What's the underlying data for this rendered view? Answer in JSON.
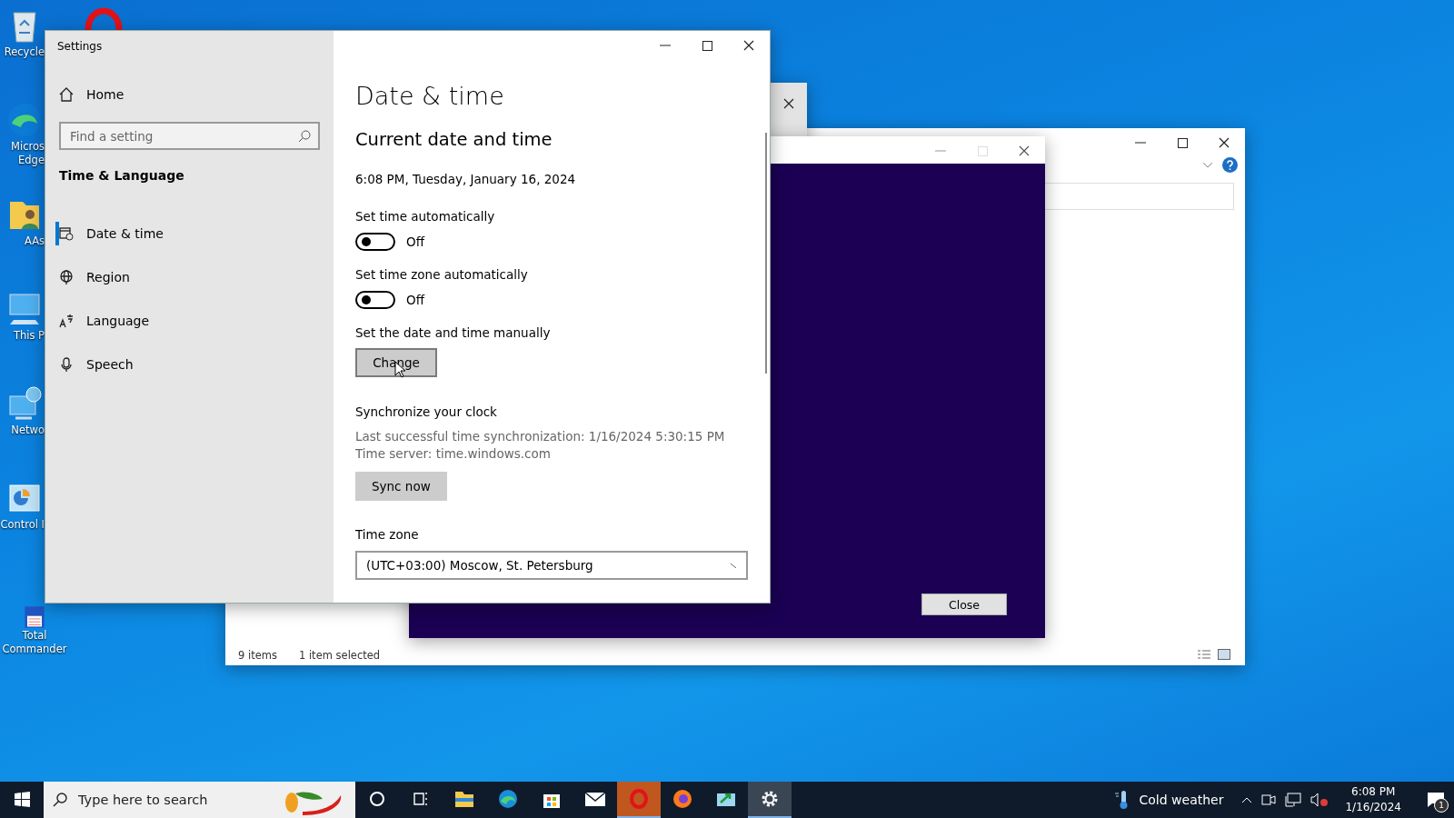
{
  "desktop_icons": [
    {
      "kind": "recycle",
      "lines": [
        "Recycle"
      ]
    },
    {
      "kind": "edge",
      "lines": [
        "Micros",
        "Edge"
      ]
    },
    {
      "kind": "user-folder",
      "lines": [
        "AAs"
      ]
    },
    {
      "kind": "pc",
      "lines": [
        "This P"
      ]
    },
    {
      "kind": "network",
      "lines": [
        "Netwo"
      ]
    },
    {
      "kind": "control",
      "lines": [
        "Control I"
      ]
    },
    {
      "kind": "floppy",
      "lines": [
        "Total",
        "Commander"
      ]
    }
  ],
  "explorer": {
    "status": [
      "9 items",
      "1 item selected"
    ]
  },
  "dialog": {
    "button": "Close"
  },
  "settings": {
    "title": "Settings",
    "home": "Home",
    "search": {
      "placeholder": "Find a setting"
    },
    "category": "Time & Language",
    "nav": [
      {
        "kind": "calendar",
        "label": "Date & time",
        "selected": true
      },
      {
        "kind": "globe",
        "label": "Region",
        "selected": false
      },
      {
        "kind": "language",
        "label": "Language",
        "selected": false
      },
      {
        "kind": "mic",
        "label": "Speech",
        "selected": false
      }
    ],
    "heading": "Date & time",
    "section": "Current date and time",
    "current": "6:08 PM, Tuesday, January 16, 2024",
    "toggles": [
      {
        "label": "Set time automatically",
        "on": false,
        "state": "Off"
      },
      {
        "label": "Set time zone automatically",
        "on": false,
        "state": "Off"
      }
    ],
    "manual": {
      "label": "Set the date and time manually",
      "button": "Change"
    },
    "sync": {
      "title": "Synchronize your clock",
      "lines": [
        "Last successful time synchronization: 1/16/2024 5:30:15 PM",
        "Time server: time.windows.com"
      ],
      "button": "Sync now"
    },
    "timezone": {
      "label": "Time zone",
      "value": "(UTC+03:00) Moscow, St. Petersburg"
    }
  },
  "taskbar": {
    "search": {
      "placeholder": "Type here to search"
    },
    "apps": [
      {
        "kind": "cortana",
        "active": false
      },
      {
        "kind": "taskview",
        "active": false
      },
      {
        "kind": "explorer",
        "active": false
      },
      {
        "kind": "edge",
        "active": false
      },
      {
        "kind": "store",
        "active": false
      },
      {
        "kind": "mail",
        "active": false
      },
      {
        "kind": "opera",
        "active": true
      },
      {
        "kind": "firefox",
        "active": false
      },
      {
        "kind": "app",
        "active": false
      },
      {
        "kind": "settings",
        "active": true
      }
    ],
    "weather": "Cold weather",
    "time": "6:08 PM",
    "date": "1/16/2024",
    "notifications": "1"
  }
}
